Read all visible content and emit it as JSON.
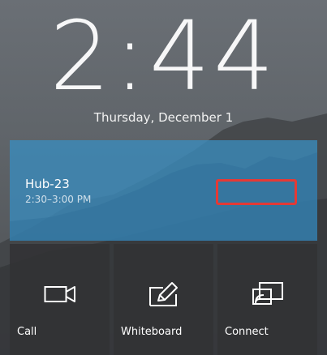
{
  "clock": {
    "time": "2:44"
  },
  "date": "Thursday, December 1",
  "meeting": {
    "title": "Hub-23",
    "time": "2:30–3:00 PM",
    "accent": "#3a8cbe",
    "highlight": "#e53935"
  },
  "tiles": [
    {
      "label": "Call",
      "icon": "video-camera-icon"
    },
    {
      "label": "Whiteboard",
      "icon": "pen-whiteboard-icon"
    },
    {
      "label": "Connect",
      "icon": "screen-cast-icon"
    }
  ]
}
